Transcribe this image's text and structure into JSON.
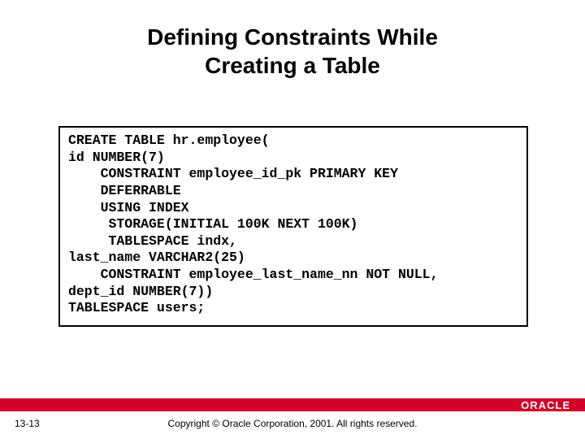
{
  "title_line1": "Defining Constraints While",
  "title_line2": "Creating a Table",
  "code": {
    "l1": "CREATE TABLE hr.employee(",
    "l2": "id NUMBER(7)",
    "l3": "    CONSTRAINT employee_id_pk PRIMARY KEY",
    "l4": "    DEFERRABLE",
    "l5": "    USING INDEX",
    "l6": "     STORAGE(INITIAL 100K NEXT 100K)",
    "l7": "     TABLESPACE indx,",
    "l8": "last_name VARCHAR2(25)",
    "l9": "    CONSTRAINT employee_last_name_nn NOT NULL,",
    "l10": "dept_id NUMBER(7))",
    "l11": "TABLESPACE users;"
  },
  "footer": {
    "page": "13-13",
    "copyright": "Copyright © Oracle Corporation, 2001. All rights reserved.",
    "logo_text": "ORACLE"
  }
}
